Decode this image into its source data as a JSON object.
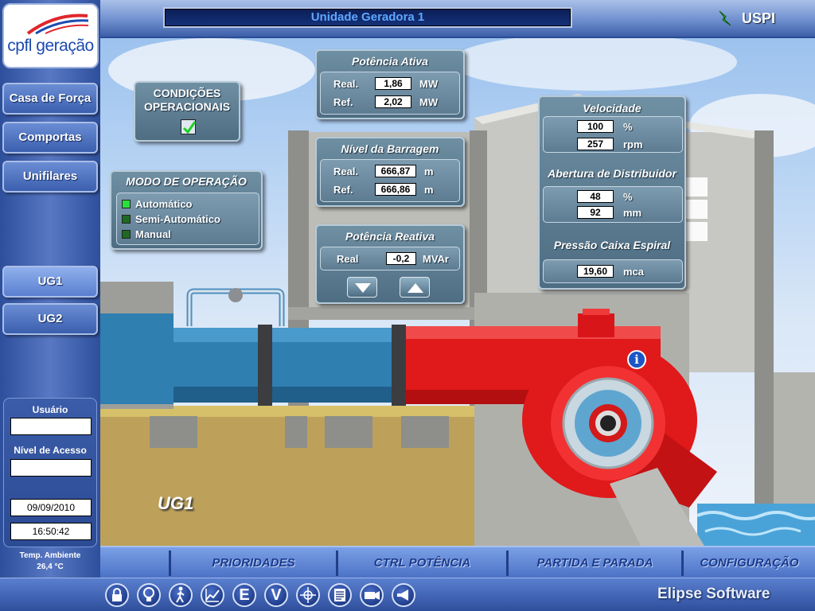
{
  "window": {
    "title": "Unidade Geradora 1",
    "status_label": "USPI"
  },
  "logo": {
    "text": "cpfl geração"
  },
  "sidebar": {
    "nav": [
      {
        "label": "Casa de Força"
      },
      {
        "label": "Comportas"
      },
      {
        "label": "Unifilares"
      }
    ],
    "units": [
      {
        "label": "UG1",
        "selected": true
      },
      {
        "label": "UG2",
        "selected": false
      }
    ],
    "user_label": "Usuário",
    "user_value": "",
    "access_label": "Nível de Acesso",
    "access_value": "",
    "date": "09/09/2010",
    "time": "16:50:42",
    "temp_label": "Temp. Ambiente",
    "temp_value": "26,4 °C"
  },
  "conditions": {
    "title": "CONDIÇÕES OPERACIONAIS",
    "checked": true
  },
  "mode": {
    "title": "MODO DE OPERAÇÃO",
    "options": [
      {
        "label": "Automático",
        "active": true
      },
      {
        "label": "Semi-Automático",
        "active": false
      },
      {
        "label": "Manual",
        "active": false
      }
    ]
  },
  "potencia_ativa": {
    "title": "Potência Ativa",
    "real_label": "Real.",
    "real_value": "1,86",
    "real_unit": "MW",
    "ref_label": "Ref.",
    "ref_value": "2,02",
    "ref_unit": "MW"
  },
  "nivel_barragem": {
    "title": "Nível da Barragem",
    "real_label": "Real.",
    "real_value": "666,87",
    "real_unit": "m",
    "ref_label": "Ref.",
    "ref_value": "666,86",
    "ref_unit": "m"
  },
  "potencia_reativa": {
    "title": "Potência Reativa",
    "real_label": "Real",
    "real_value": "-0,2",
    "real_unit": "MVAr"
  },
  "velocidade": {
    "title": "Velocidade",
    "percent_value": "100",
    "percent_unit": "%",
    "rpm_value": "257",
    "rpm_unit": "rpm"
  },
  "distribuidor": {
    "title": "Abertura de Distribuidor",
    "percent_value": "48",
    "percent_unit": "%",
    "mm_value": "92",
    "mm_unit": "mm"
  },
  "pressao": {
    "title": "Pressão Caixa Espiral",
    "value": "19,60",
    "unit": "mca"
  },
  "scene": {
    "unit_label": "UG1"
  },
  "tabs": [
    {
      "label": "PRIORIDADES"
    },
    {
      "label": "CTRL POTÊNCIA"
    },
    {
      "label": "PARTIDA E PARADA"
    },
    {
      "label": "CONFIGURAÇÃO"
    }
  ],
  "toolbar": {
    "icons": [
      "lock-icon",
      "bulb-icon",
      "walker-icon",
      "trend-icon",
      "e-icon",
      "v-icon",
      "crosshair-icon",
      "list-icon",
      "camera-icon",
      "megaphone-icon"
    ],
    "e_letter": "E",
    "v_letter": "V",
    "brand": "Elipse Software"
  },
  "colors": {
    "pipe_red": "#e0191a",
    "pipe_blue": "#2f7fb0",
    "led_on": "#29e03a"
  }
}
